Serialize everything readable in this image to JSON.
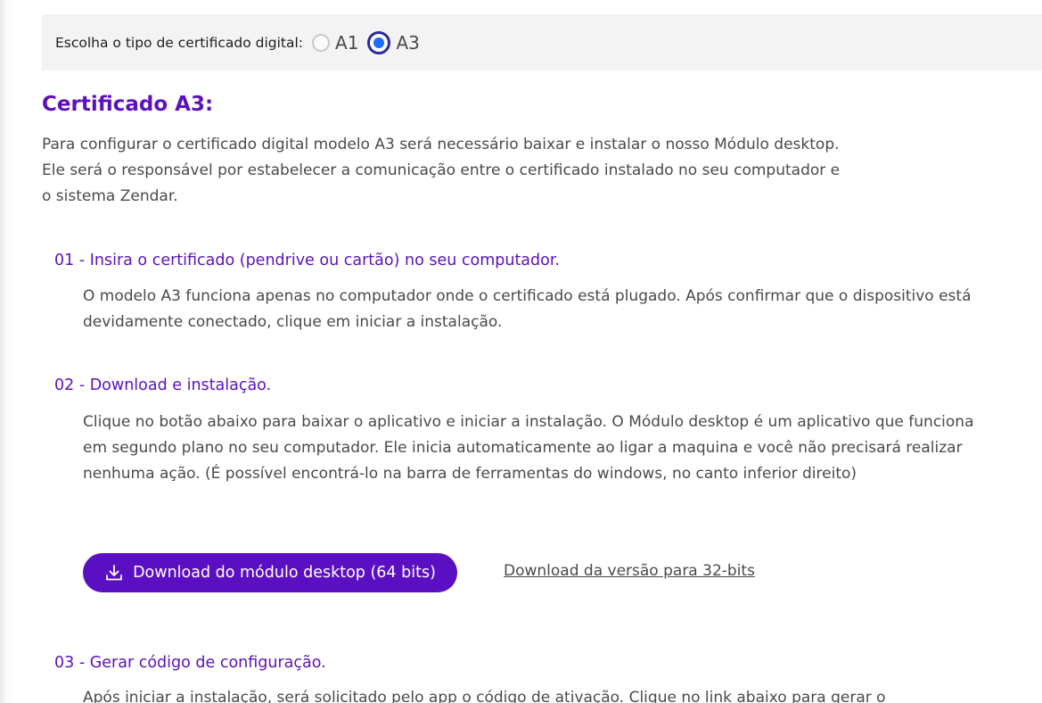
{
  "cert_type": {
    "label": "Escolha o tipo de certificado digital:",
    "options": [
      {
        "label": "A1",
        "selected": false
      },
      {
        "label": "A3",
        "selected": true
      }
    ]
  },
  "section": {
    "title": "Certificado A3:",
    "intro": "Para configurar o certificado digital modelo A3 será necessário baixar e instalar o nosso Módulo desktop. Ele será o responsável por estabelecer a comunicação entre o certificado instalado no seu computador e o sistema Zendar."
  },
  "steps": [
    {
      "title": "01 - Insira o certificado (pendrive ou cartão) no seu computador.",
      "text": "O modelo A3 funciona apenas no computador onde o certificado está plugado. Após confirmar que o dispositivo está devidamente conectado, clique em iniciar a instalação."
    },
    {
      "title": "02 - Download e instalação.",
      "text": "Clique no botão abaixo para baixar o aplicativo e iniciar a instalação. O Módulo desktop é um aplicativo que funciona em segundo plano no seu computador. Ele inicia automaticamente ao ligar a maquina e você não precisará realizar nenhuma ação. (É possível encontrá-lo na barra de ferramentas do windows, no canto inferior direito)"
    },
    {
      "title": "03 - Gerar código de configuração.",
      "text": "Após iniciar a instalação, será solicitado pelo app o código de ativação. Clique no link abaixo para gerar o"
    }
  ],
  "download": {
    "button_label": "Download do módulo desktop (64 bits)",
    "link_32": "Download da versão para 32-bits",
    "icon": "download-icon"
  },
  "colors": {
    "accent": "#5b12b8",
    "button": "#5b0fc2",
    "radio_selected": "#1d6cff"
  }
}
